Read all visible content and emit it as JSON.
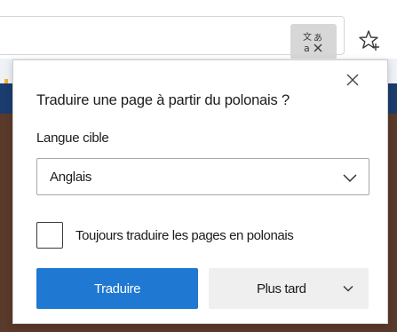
{
  "browser": {
    "toolbar_buttons": [
      {
        "icon": "translate-icon",
        "state": "active"
      },
      {
        "icon": "favorite-star-icon"
      }
    ]
  },
  "translate_popup": {
    "title": "Traduire une page à partir du polonais ?",
    "close_icon": "close-icon",
    "target_language_label": "Langue cible",
    "target_language_value": "Anglais",
    "always_translate_label": "Toujours traduire les pages en polonais",
    "always_translate_checked": false,
    "translate_button_label": "Traduire",
    "later_button_label": "Plus tard"
  },
  "colors": {
    "accent": "#1f78d1",
    "secondary_button": "#efefef",
    "toolbar_active": "#d7d7d7"
  }
}
